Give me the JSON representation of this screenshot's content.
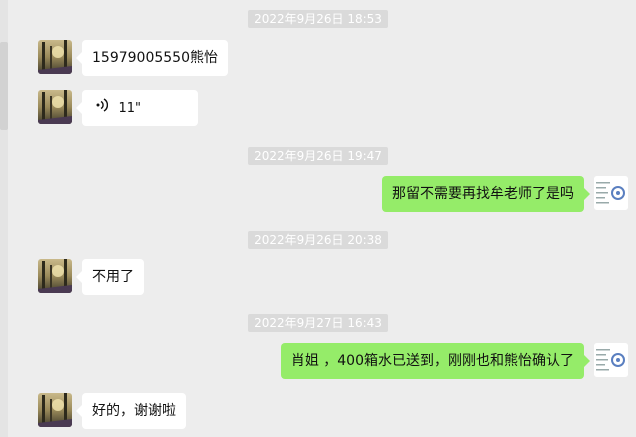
{
  "colors": {
    "background": "#ededed",
    "bubble_sent": "#95ec69",
    "bubble_received": "#ffffff",
    "timestamp_bg": "#dadada"
  },
  "messages": {
    "ts1": "2022年9月26日 18:53",
    "msg1": "15979005550熊怡",
    "voice": {
      "icon": "voice-wave-icon",
      "duration": "11\""
    },
    "ts2": "2022年9月26日 19:47",
    "msg3": "那留不需要再找牟老师了是吗",
    "ts3": "2022年9月26日 20:38",
    "msg4": "不用了",
    "ts4": "2022年9月27日 16:43",
    "msg5": "肖姐 ，400箱水已送到，刚刚也和熊怡确认了",
    "msg6": "好的，谢谢啦"
  }
}
